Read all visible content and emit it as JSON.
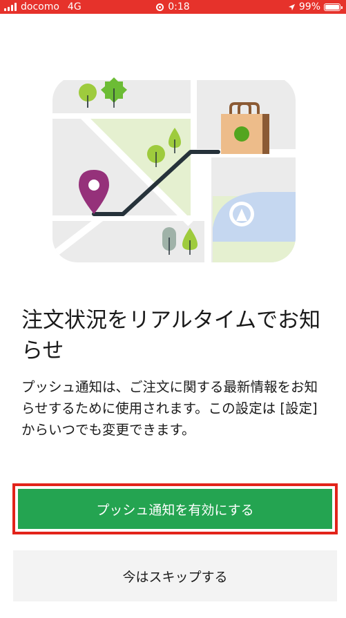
{
  "status_bar": {
    "carrier": "docomo",
    "network": "4G",
    "time": "0:18",
    "battery_percent": "99%",
    "battery_level": 0.99
  },
  "illustration": {
    "icons": [
      "map-icon",
      "location-pin-icon",
      "shopping-bag-icon",
      "tree-icon"
    ],
    "colors": {
      "road": "#ffffff",
      "block": "#ebebeb",
      "park": "#e5f0d0",
      "route": "#26323a",
      "pin": "#95317a",
      "bag": "#edbc8a",
      "bag_dot": "#53a51f",
      "water": "#c5d7f0"
    }
  },
  "main": {
    "title": "注文状況をリアルタイムでお知らせ",
    "description": "プッシュ通知は、ご注文に関する最新情報をお知らせするために使用されます。この設定は [設定] からいつでも変更できます。"
  },
  "buttons": {
    "enable": "プッシュ通知を有効にする",
    "skip": "今はスキップする"
  },
  "colors": {
    "status_bar": "#e6322b",
    "primary": "#24a451",
    "highlight_border": "#e2231a",
    "secondary_bg": "#f3f3f3"
  }
}
